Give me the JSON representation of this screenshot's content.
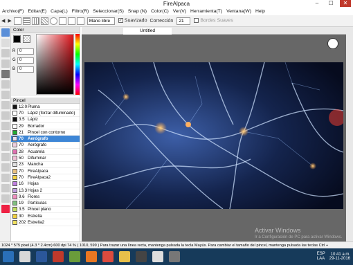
{
  "window": {
    "title": "FireAlpaca",
    "min": "–",
    "max": "☐",
    "close": "✕"
  },
  "menu": [
    "Archivo(F)",
    "Editar(E)",
    "Capa(L)",
    "Filtro(R)",
    "Seleccionar(S)",
    "Snap (N)",
    "Color(C)",
    "Ver(V)",
    "Herramienta(T)",
    "Ventana(W)",
    "Help"
  ],
  "toolbar": {
    "mode": "Mano libre",
    "smooth_label": "Suavizado",
    "correction_label": "Corrección",
    "correction_value": "21",
    "soft_edges_label": "Bordes Suaves"
  },
  "color_panel": {
    "title": "Color",
    "r_label": "R",
    "g_label": "G",
    "b_label": "B",
    "r": "0",
    "g": "0",
    "b": "0"
  },
  "brush_panel": {
    "title": "Pincel",
    "brushes": [
      {
        "size": "12.0",
        "name": "Pluma",
        "color": "#111111"
      },
      {
        "size": "70",
        "name": "Lápiz (forzar difuminado)",
        "color": "#ffffff"
      },
      {
        "size": "3.5",
        "name": "Lápiz",
        "color": "#111111"
      },
      {
        "size": "29",
        "name": "Borrador",
        "color": "#ffffff"
      },
      {
        "size": "21",
        "name": "Pincel con contorno",
        "color": "#22aa33"
      },
      {
        "size": "70",
        "name": "Aerógrafo",
        "color": "#e8e0f0"
      },
      {
        "size": "70",
        "name": "Aerógrafo",
        "color": "#f0d0e0"
      },
      {
        "size": "28",
        "name": "Acuarela",
        "color": "#e070b0"
      },
      {
        "size": "50",
        "name": "Difuminar",
        "color": "#f0c0d8"
      },
      {
        "size": "23",
        "name": "Mancha",
        "color": "#e0e0e0"
      },
      {
        "size": "70",
        "name": "FireAlpaca",
        "color": "#e8c080"
      },
      {
        "size": "70",
        "name": "FireAlpaca2",
        "color": "#f0d040"
      },
      {
        "size": "16",
        "name": "Hojas",
        "color": "#c080e0"
      },
      {
        "size": "13.3",
        "name": "Hojas 2",
        "color": "#c0a0e0"
      },
      {
        "size": "9.6",
        "name": "Flores",
        "color": "#f090c0"
      },
      {
        "size": "19",
        "name": "Partículas",
        "color": "#80c080"
      },
      {
        "size": "3.5",
        "name": "Pincel plano",
        "color": "#c0e060"
      },
      {
        "size": "30",
        "name": "Estrella",
        "color": "#f0d040"
      },
      {
        "size": "202",
        "name": "Estrella2",
        "color": "#f0e060"
      }
    ],
    "selected_index": 5
  },
  "document": {
    "tab_title": "Untitled"
  },
  "watermark": {
    "line1": "Activar Windows",
    "line2": "Ir a Configuración de PC para activar Windows."
  },
  "status": {
    "text": "1024 * 575 pixel   (4.3 * 2.4cm)   600 dpi   74 %   ( 1010, 599 )   Para trazar una línea recta, mantenga pulsada la tecla Mayús. Para cambiar el tamaño del pincel, mantenga pulsada las teclas Ctrl +"
  },
  "taskbar": {
    "lang": "ESP\nLAA",
    "time": "10:41 a.m.",
    "date": "29-11-2016"
  }
}
